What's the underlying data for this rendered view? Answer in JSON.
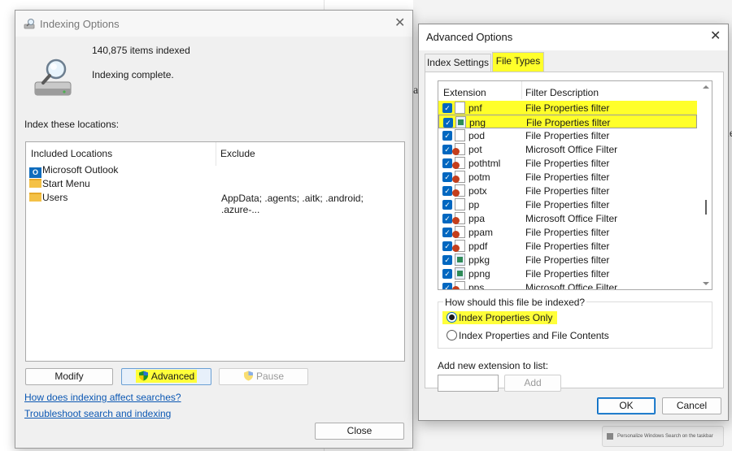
{
  "indexing_window": {
    "title": "Indexing Options",
    "items_indexed": "140,875 items indexed",
    "status": "Indexing complete.",
    "locations_label": "Index these locations:",
    "columns": {
      "included": "Included Locations",
      "exclude": "Exclude"
    },
    "locations": [
      {
        "icon": "outlook-icon",
        "name": "Microsoft Outlook",
        "exclude": ""
      },
      {
        "icon": "folder-icon",
        "name": "Start Menu",
        "exclude": ""
      },
      {
        "icon": "folder-icon",
        "name": "Users",
        "exclude": "AppData; .agents; .aitk; .android; .azure-..."
      }
    ],
    "buttons": {
      "modify": "Modify",
      "advanced": "Advanced",
      "pause": "Pause",
      "close": "Close"
    },
    "links": {
      "how_indexing": "How does indexing affect searches?",
      "troubleshoot": "Troubleshoot search and indexing"
    }
  },
  "advanced_window": {
    "title": "Advanced Options",
    "tabs": [
      "Index Settings",
      "File Types"
    ],
    "active_tab": "File Types",
    "columns": {
      "extension": "Extension",
      "description": "Filter Description"
    },
    "extensions": [
      {
        "ext": "pnf",
        "desc": "File Properties filter",
        "checked": true,
        "icon": "generic"
      },
      {
        "ext": "png",
        "desc": "File Properties filter",
        "checked": true,
        "icon": "image",
        "selected": true
      },
      {
        "ext": "pod",
        "desc": "File Properties filter",
        "checked": true,
        "icon": "generic"
      },
      {
        "ext": "pot",
        "desc": "Microsoft Office Filter",
        "checked": true,
        "icon": "powerpoint"
      },
      {
        "ext": "pothtml",
        "desc": "File Properties filter",
        "checked": true,
        "icon": "powerpoint"
      },
      {
        "ext": "potm",
        "desc": "File Properties filter",
        "checked": true,
        "icon": "powerpoint"
      },
      {
        "ext": "potx",
        "desc": "File Properties filter",
        "checked": true,
        "icon": "powerpoint"
      },
      {
        "ext": "pp",
        "desc": "File Properties filter",
        "checked": true,
        "icon": "generic"
      },
      {
        "ext": "ppa",
        "desc": "Microsoft Office Filter",
        "checked": true,
        "icon": "powerpoint"
      },
      {
        "ext": "ppam",
        "desc": "File Properties filter",
        "checked": true,
        "icon": "powerpoint"
      },
      {
        "ext": "ppdf",
        "desc": "File Properties filter",
        "checked": true,
        "icon": "powerpoint"
      },
      {
        "ext": "ppkg",
        "desc": "File Properties filter",
        "checked": true,
        "icon": "image"
      },
      {
        "ext": "ppng",
        "desc": "File Properties filter",
        "checked": true,
        "icon": "image"
      },
      {
        "ext": "pps",
        "desc": "Microsoft Office Filter",
        "checked": true,
        "icon": "powerpoint"
      }
    ],
    "index_how_label": "How should this file be indexed?",
    "radio_options": [
      {
        "label": "Index Properties Only",
        "checked": true
      },
      {
        "label": "Index Properties and File Contents",
        "checked": false
      }
    ],
    "add_extension_label": "Add new extension to list:",
    "add_extension_value": "",
    "buttons": {
      "add": "Add",
      "ok": "OK",
      "cancel": "Cancel"
    }
  },
  "background": {
    "taskbar_tip": "Personalize Windows Search on the taskbar",
    "fragments": [
      "a",
      "le"
    ]
  },
  "colors": {
    "highlight": "#ffff2a",
    "accent": "#0067c0",
    "link": "#0b57b3"
  }
}
